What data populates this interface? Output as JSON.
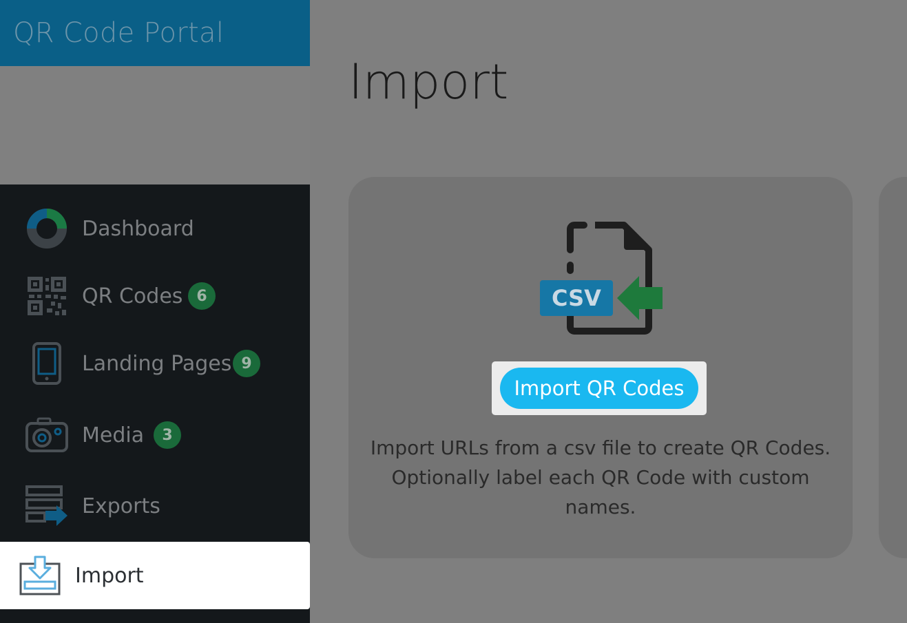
{
  "brand": {
    "title": "QR Code Portal"
  },
  "nav": {
    "items": [
      {
        "label": "Dashboard",
        "icon": "dashboard-donut-icon"
      },
      {
        "label": "QR Codes",
        "icon": "qr-code-icon",
        "badge": "6"
      },
      {
        "label": "Landing Pages",
        "icon": "mobile-phone-icon",
        "badge": "9"
      },
      {
        "label": "Media",
        "icon": "camera-icon",
        "badge": "3"
      },
      {
        "label": "Exports",
        "icon": "export-stack-icon"
      },
      {
        "label": "Import",
        "icon": "import-tray-icon",
        "active": true
      }
    ]
  },
  "main": {
    "title": "Import",
    "card": {
      "icon_label": "CSV",
      "button_label": "Import QR Codes",
      "description": "Import URLs from a csv file to create QR Codes. Optionally label each QR Code with custom names."
    }
  },
  "colors": {
    "brand_bar": "#0a5f87",
    "sidebar_bg": "#14181b",
    "button": "#1ab8f0",
    "badge": "#1a6a3a",
    "csv_blue": "#1677a6",
    "arrow_green": "#1e7a3c"
  }
}
